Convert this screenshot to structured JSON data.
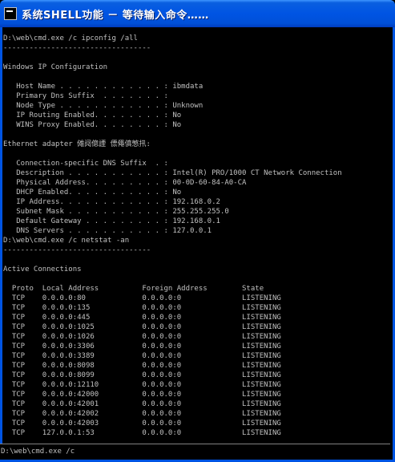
{
  "window": {
    "title": "系统SHELL功能 － 等待输入命令……"
  },
  "output_lines": [
    "D:\\web\\cmd.exe /c ipconfig /all",
    "----------------------------------",
    "",
    "Windows IP Configuration",
    "",
    "   Host Name . . . . . . . . . . . . : ibmdata",
    "   Primary Dns Suffix  . . . . . . . :",
    "   Node Type . . . . . . . . . . . . : Unknown",
    "   IP Routing Enabled. . . . . . . . : No",
    "   WINS Proxy Enabled. . . . . . . . : No",
    "",
    "Ethernet adapter 傩阋傯諲 僄僶傎慜扟:",
    "",
    "   Connection-specific DNS Suffix  . :",
    "   Description . . . . . . . . . . . : Intel(R) PRO/1000 CT Network Connection",
    "   Physical Address. . . . . . . . . : 00-0D-60-84-A0-CA",
    "   DHCP Enabled. . . . . . . . . . . : No",
    "   IP Address. . . . . . . . . . . . : 192.168.0.2",
    "   Subnet Mask . . . . . . . . . . . : 255.255.255.0",
    "   Default Gateway . . . . . . . . . : 192.168.0.1",
    "   DNS Servers . . . . . . . . . . . : 127.0.0.1",
    "D:\\web\\cmd.exe /c netstat -an",
    "----------------------------------",
    "",
    "Active Connections",
    "",
    "  Proto  Local Address          Foreign Address        State",
    "  TCP    0.0.0.0:80             0.0.0.0:0              LISTENING",
    "  TCP    0.0.0.0:135            0.0.0.0:0              LISTENING",
    "  TCP    0.0.0.0:445            0.0.0.0:0              LISTENING",
    "  TCP    0.0.0.0:1025           0.0.0.0:0              LISTENING",
    "  TCP    0.0.0.0:1026           0.0.0.0:0              LISTENING",
    "  TCP    0.0.0.0:3306           0.0.0.0:0              LISTENING",
    "  TCP    0.0.0.0:3389           0.0.0.0:0              LISTENING",
    "  TCP    0.0.0.0:8098           0.0.0.0:0              LISTENING",
    "  TCP    0.0.0.0:8099           0.0.0.0:0              LISTENING",
    "  TCP    0.0.0.0:12110          0.0.0.0:0              LISTENING",
    "  TCP    0.0.0.0:42000          0.0.0.0:0              LISTENING",
    "  TCP    0.0.0.0:42001          0.0.0.0:0              LISTENING",
    "  TCP    0.0.0.0:42002          0.0.0.0:0              LISTENING",
    "  TCP    0.0.0.0:42003          0.0.0.0:0              LISTENING",
    "  TCP    127.0.0.1:53           0.0.0.0:0              LISTENING"
  ],
  "command_input": {
    "value": "D:\\web\\cmd.exe /c"
  },
  "colors": {
    "background": "#000000",
    "text": "#c0c0c0",
    "titlebar": "#0054e3"
  },
  "icons": {
    "title": "console-icon"
  }
}
